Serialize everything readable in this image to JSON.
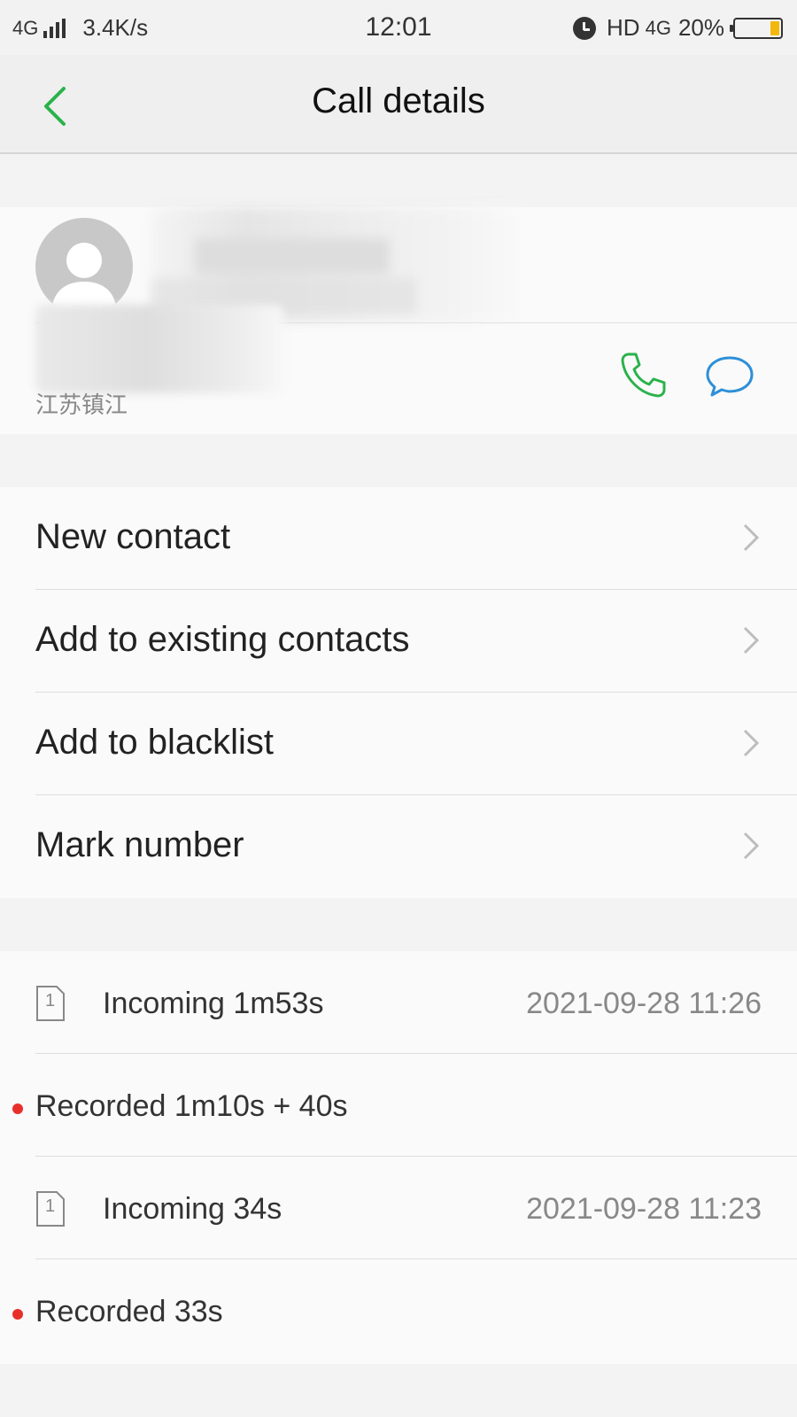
{
  "status_bar": {
    "network": "4G",
    "speed": "3.4K/s",
    "time": "12:01",
    "hd": "HD",
    "network_right": "4G",
    "battery_percent": "20%",
    "battery_level": 0.2
  },
  "header": {
    "title": "Call details"
  },
  "contact": {
    "location": "江苏镇江"
  },
  "options": [
    {
      "label": "New contact"
    },
    {
      "label": "Add to existing contacts"
    },
    {
      "label": "Add to blacklist"
    },
    {
      "label": "Mark number"
    }
  ],
  "call_log": [
    {
      "type": "Incoming 1m53s",
      "time": "2021-09-28 11:26",
      "sim": "1"
    },
    {
      "recording": "Recorded 1m10s + 40s"
    },
    {
      "type": "Incoming 34s",
      "time": "2021-09-28 11:23",
      "sim": "1"
    },
    {
      "recording": "Recorded 33s"
    }
  ],
  "colors": {
    "accent_green": "#2bb24c",
    "message_blue": "#2e8fd8",
    "record_red": "#e8302a",
    "battery_yellow": "#f2b90c"
  }
}
